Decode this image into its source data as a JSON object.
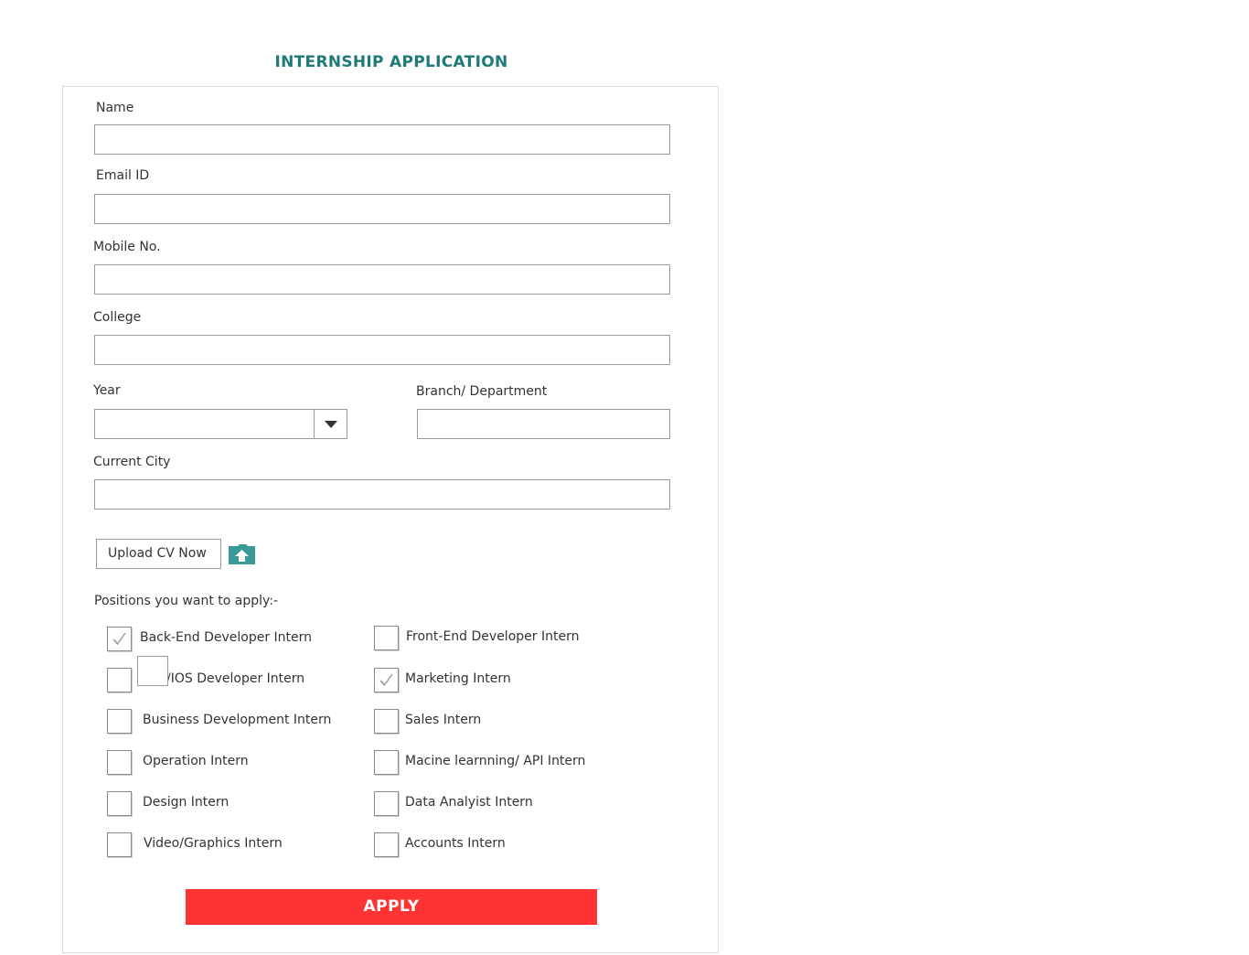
{
  "form": {
    "title": "INTERNSHIP APPLICATION",
    "fields": {
      "name": {
        "label": "Name",
        "value": ""
      },
      "email": {
        "label": "Email ID",
        "value": ""
      },
      "mobile": {
        "label": "Mobile No.",
        "value": ""
      },
      "college": {
        "label": "College",
        "value": ""
      },
      "year": {
        "label": "Year",
        "value": ""
      },
      "branch": {
        "label": "Branch/ Department",
        "value": ""
      },
      "city": {
        "label": "Current City",
        "value": ""
      }
    },
    "upload": {
      "label": "Upload CV Now",
      "icon": "upload-folder-icon"
    },
    "positions_label": "Positions you want to apply:-",
    "positions": [
      {
        "label": "Back-End Developer Intern",
        "checked": true
      },
      {
        "label": "Front-End Developer Intern",
        "checked": false
      },
      {
        "label": "/IOS Developer Intern",
        "checked": false
      },
      {
        "label": "Marketing Intern",
        "checked": true
      },
      {
        "label": "Business Development Intern",
        "checked": false
      },
      {
        "label": "Sales Intern",
        "checked": false
      },
      {
        "label": "Operation Intern",
        "checked": false
      },
      {
        "label": "Macine learnning/ API Intern",
        "checked": false
      },
      {
        "label": "Design Intern",
        "checked": false
      },
      {
        "label": "Data Analyist Intern",
        "checked": false
      },
      {
        "label": "Video/Graphics Intern",
        "checked": false
      },
      {
        "label": "Accounts Intern",
        "checked": false
      }
    ],
    "apply_label": "APPLY"
  },
  "colors": {
    "title": "#1d7a78",
    "apply_bg": "#ff3333",
    "upload_icon": "#3a9a98"
  }
}
